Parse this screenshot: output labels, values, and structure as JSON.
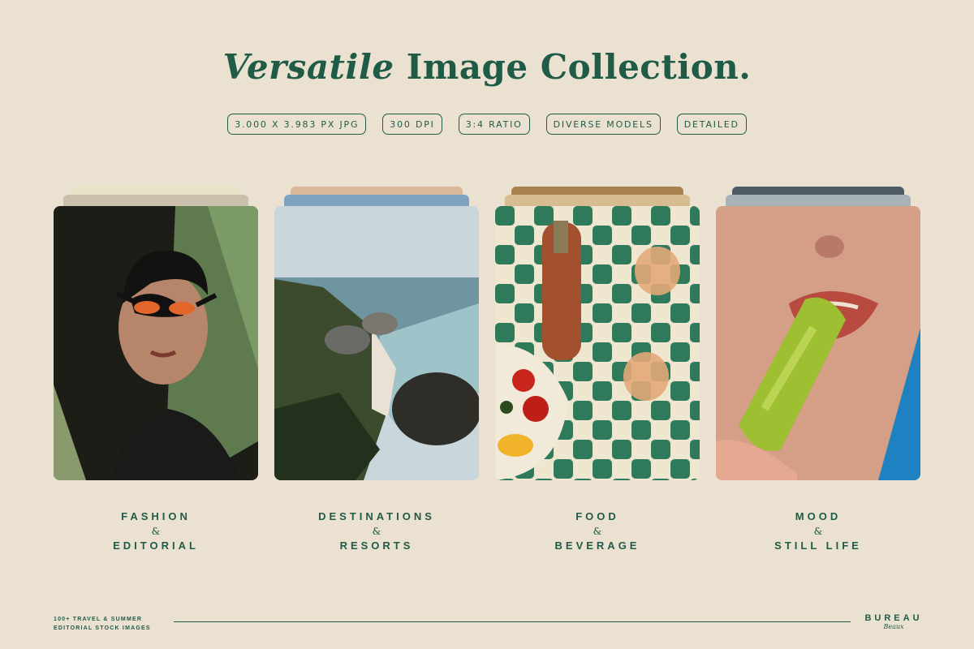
{
  "title": {
    "italic": "Versatile",
    "rest": " Image Collection."
  },
  "tags": [
    "3.000 X 3.983 PX JPG",
    "300 DPI",
    "3:4 RATIO",
    "DIVERSE MODELS",
    "DETAILED"
  ],
  "cards": [
    {
      "line1": "FASHION",
      "amp": "&",
      "line2": "EDITORIAL"
    },
    {
      "line1": "DESTINATIONS",
      "amp": "&",
      "line2": "RESORTS"
    },
    {
      "line1": "FOOD",
      "amp": "&",
      "line2": "BEVERAGE"
    },
    {
      "line1": "MOOD",
      "amp": "&",
      "line2": "STILL LIFE"
    }
  ],
  "footer": {
    "left_line1": "100+ TRAVEL & SUMMER",
    "left_line2": "EDITORIAL STOCK IMAGES",
    "brand": "BUREAU",
    "brand_sub": "Beaux"
  },
  "colors": {
    "background": "#ebe1d0",
    "accent": "#1f5b47"
  }
}
